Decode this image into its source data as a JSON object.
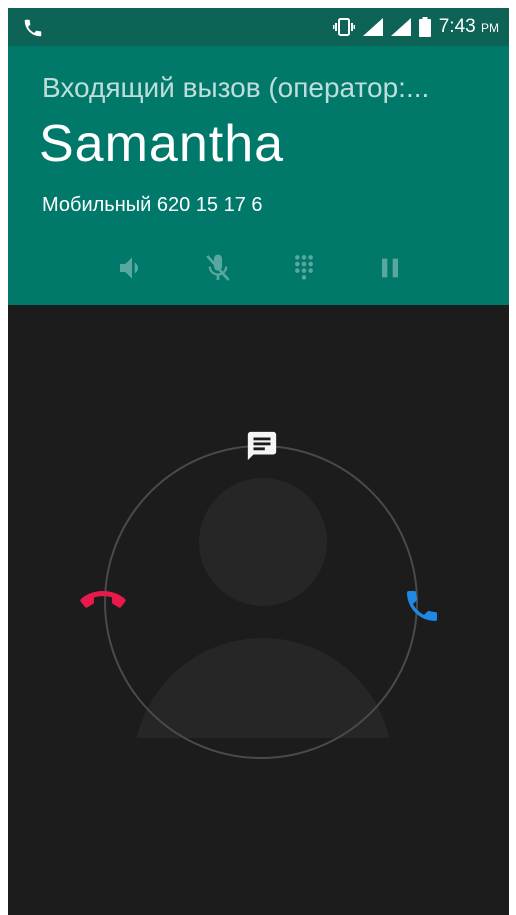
{
  "status_bar": {
    "time": "7:43",
    "ampm": "PM",
    "icons": [
      "phone-icon",
      "vibrate-icon",
      "signal-icon",
      "signal-icon",
      "battery-icon"
    ]
  },
  "call": {
    "incoming_label": "Входящий вызов (оператор:...",
    "caller_name": "Samantha",
    "caller_number": "Мобильный 620 15 17 6"
  },
  "controls": [
    "speaker-icon",
    "mute-icon",
    "dialpad-icon",
    "hold-icon"
  ],
  "actions": [
    "message-icon",
    "decline-call-icon",
    "answer-call-icon"
  ],
  "colors": {
    "status_bar": "#0d6356",
    "header": "#00796b",
    "background": "#1c1c1c",
    "decline": "#e8194b",
    "answer": "#1e88e5"
  }
}
